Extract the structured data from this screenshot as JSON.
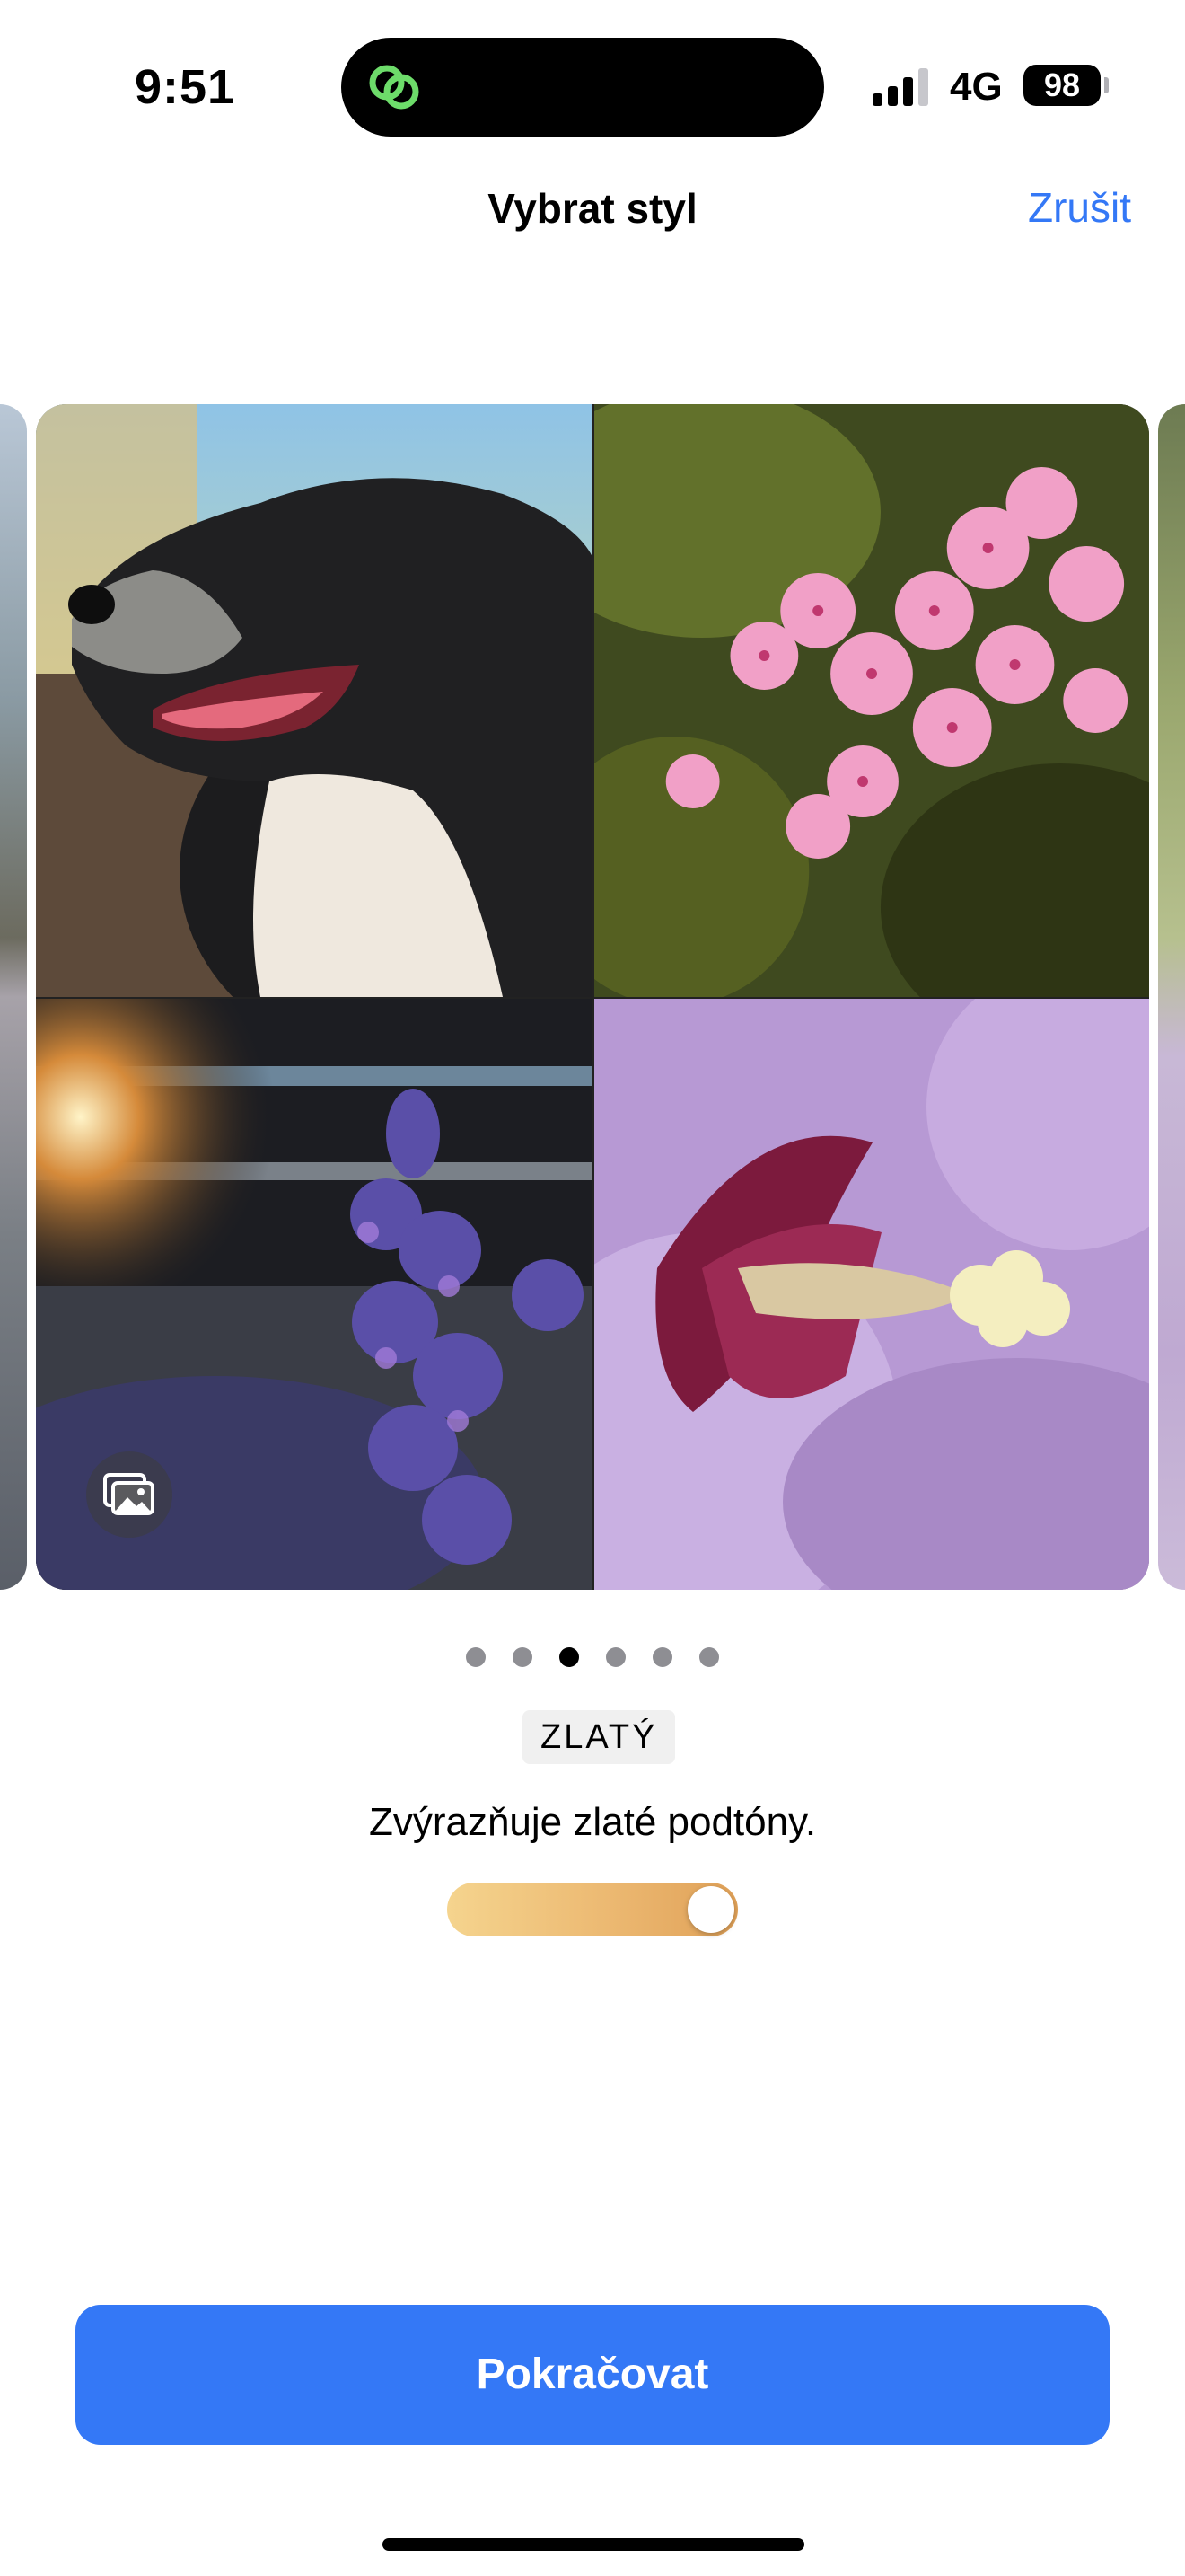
{
  "status_bar": {
    "time": "9:51",
    "network": "4G",
    "battery": "98",
    "signal_bars_active": 3,
    "signal_bars_total": 4
  },
  "nav": {
    "title": "Vybrat styl",
    "cancel_label": "Zrušit"
  },
  "carousel": {
    "page_count": 6,
    "active_page": 3,
    "photos": [
      "dog-photo",
      "pink-flowers-photo",
      "lavender-photo",
      "hibiscus-photo"
    ]
  },
  "style": {
    "name": "ZLATÝ",
    "description": "Zvýrazňuje zlaté podtóny.",
    "intensity": 1.0
  },
  "actions": {
    "continue_label": "Pokračovat"
  },
  "colors": {
    "accent": "#3478f6",
    "slider_start": "#f5d48e",
    "slider_end": "#e0a158"
  }
}
